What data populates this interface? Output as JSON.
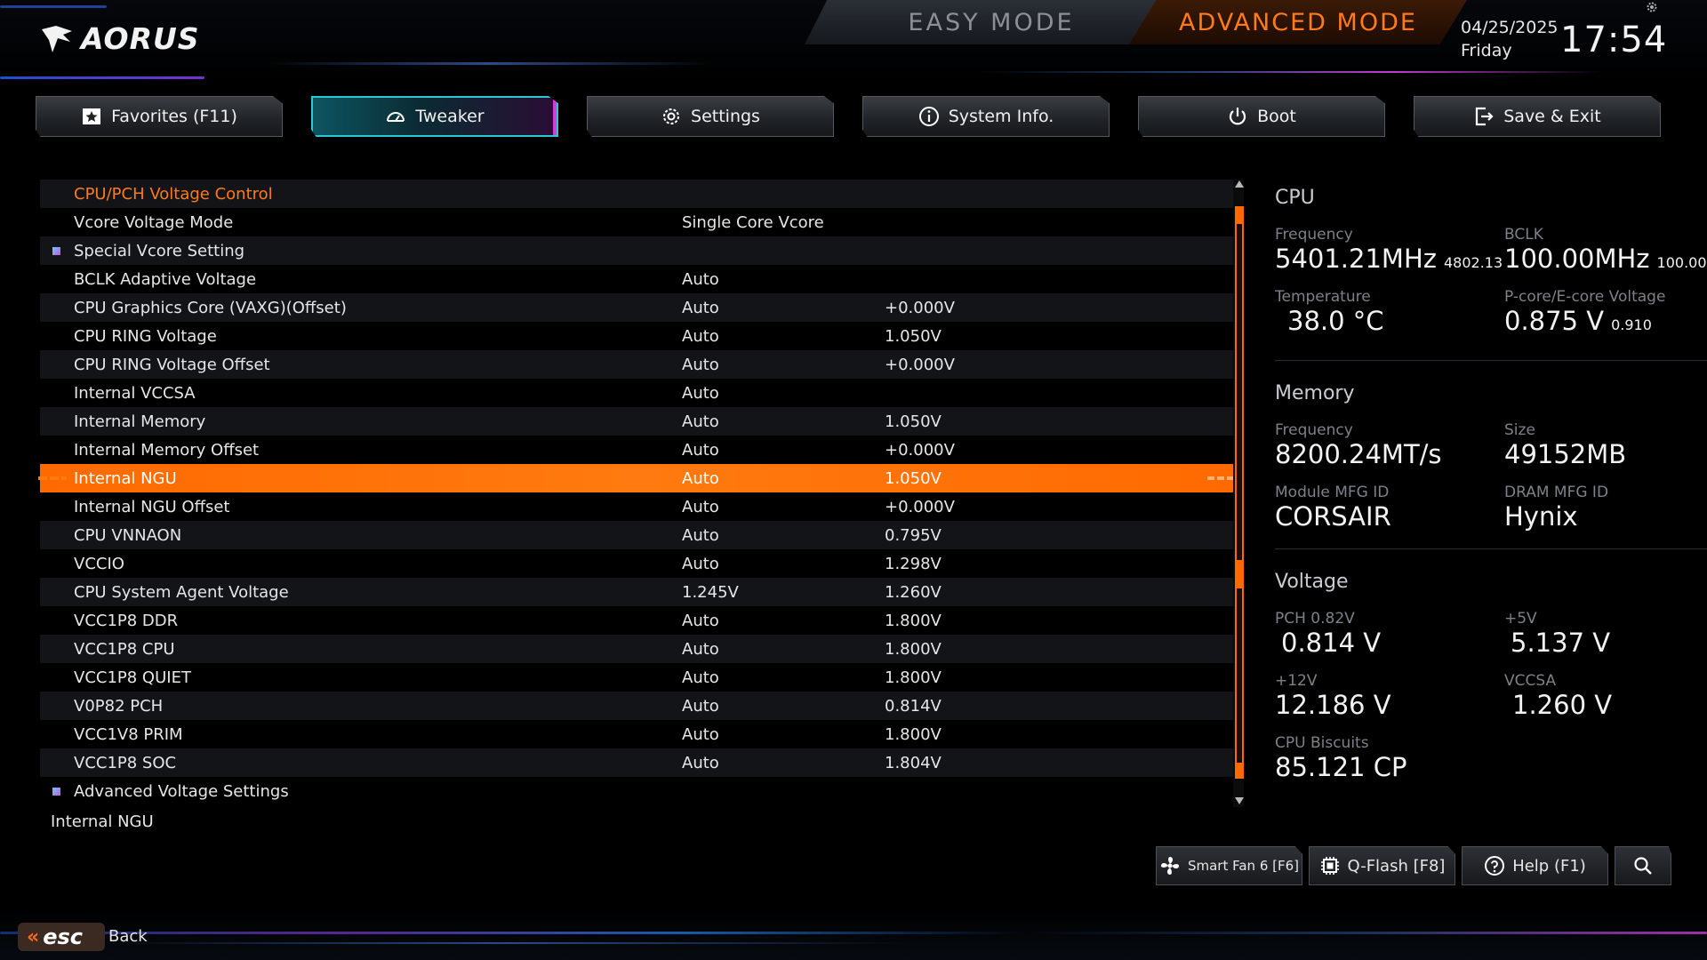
{
  "brand": {
    "logo_text": "AORUS"
  },
  "modes": {
    "easy": "EASY MODE",
    "advanced": "ADVANCED MODE"
  },
  "datetime": {
    "date": "04/25/2025",
    "day": "Friday",
    "time": "17:54"
  },
  "tabs": [
    {
      "label": "Favorites (F11)",
      "icon": "star-icon",
      "active": false
    },
    {
      "label": "Tweaker",
      "icon": "speedometer-icon",
      "active": true
    },
    {
      "label": "Settings",
      "icon": "gear-icon",
      "active": false
    },
    {
      "label": "System Info.",
      "icon": "info-icon",
      "active": false
    },
    {
      "label": "Boot",
      "icon": "power-icon",
      "active": false
    },
    {
      "label": "Save & Exit",
      "icon": "exit-icon",
      "active": false
    }
  ],
  "list": {
    "rows": [
      {
        "name": "CPU/PCH Voltage Control",
        "value": "",
        "current": "",
        "type": "header"
      },
      {
        "name": "Vcore Voltage Mode",
        "value": "Single Core Vcore",
        "current": ""
      },
      {
        "name": "Special Vcore Setting",
        "value": "",
        "current": "",
        "type": "submenu"
      },
      {
        "name": "BCLK Adaptive Voltage",
        "value": "Auto",
        "current": ""
      },
      {
        "name": "CPU Graphics Core (VAXG)(Offset)",
        "value": "Auto",
        "current": "+0.000V"
      },
      {
        "name": "CPU RING Voltage",
        "value": "Auto",
        "current": "1.050V"
      },
      {
        "name": "CPU RING Voltage Offset",
        "value": "Auto",
        "current": "+0.000V"
      },
      {
        "name": "Internal VCCSA",
        "value": "Auto",
        "current": ""
      },
      {
        "name": "Internal Memory",
        "value": "Auto",
        "current": "1.050V"
      },
      {
        "name": "Internal Memory Offset",
        "value": "Auto",
        "current": "+0.000V"
      },
      {
        "name": "Internal NGU",
        "value": "Auto",
        "current": "1.050V",
        "selected": true
      },
      {
        "name": "Internal NGU Offset",
        "value": "Auto",
        "current": "+0.000V"
      },
      {
        "name": "CPU VNNAON",
        "value": "Auto",
        "current": "0.795V"
      },
      {
        "name": "VCCIO",
        "value": "Auto",
        "current": "1.298V"
      },
      {
        "name": "CPU System Agent Voltage",
        "value": "1.245V",
        "current": "1.260V"
      },
      {
        "name": "VCC1P8 DDR",
        "value": "Auto",
        "current": "1.800V"
      },
      {
        "name": "VCC1P8 CPU",
        "value": "Auto",
        "current": "1.800V"
      },
      {
        "name": "VCC1P8 QUIET",
        "value": "Auto",
        "current": "1.800V"
      },
      {
        "name": "V0P82 PCH",
        "value": "Auto",
        "current": "0.814V"
      },
      {
        "name": "VCC1V8 PRIM",
        "value": "Auto",
        "current": "1.800V"
      },
      {
        "name": "VCC1P8 SOC",
        "value": "Auto",
        "current": "1.804V"
      },
      {
        "name": "Advanced Voltage Settings",
        "value": "",
        "current": "",
        "type": "submenu"
      }
    ],
    "help_text": "Internal NGU"
  },
  "panel": {
    "cpu": {
      "title": "CPU",
      "frequency_label": "Frequency",
      "frequency": "5401.21MHz",
      "frequency_small": "4802.13",
      "bclk_label": "BCLK",
      "bclk": "100.00MHz",
      "bclk_small": "100.00",
      "temp_label": "Temperature",
      "temp": "38.0 °C",
      "voltage_label": "P-core/E-core Voltage",
      "voltage": "0.875 V",
      "voltage_small": "0.910"
    },
    "memory": {
      "title": "Memory",
      "frequency_label": "Frequency",
      "frequency": "8200.24MT/s",
      "size_label": "Size",
      "size": "49152MB",
      "module_label": "Module MFG ID",
      "module": "CORSAIR",
      "dram_label": "DRAM MFG ID",
      "dram": "Hynix"
    },
    "voltage": {
      "title": "Voltage",
      "pch_label": "PCH 0.82V",
      "pch": "0.814 V",
      "v5_label": "+5V",
      "v5": "5.137 V",
      "v12_label": "+12V",
      "v12": "12.186 V",
      "vccsa_label": "VCCSA",
      "vccsa": "1.260 V",
      "biscuits_label": "CPU Biscuits",
      "biscuits": "85.121 CP"
    }
  },
  "bottom": {
    "smartfan": "Smart Fan 6 [F6]",
    "qflash": "Q-Flash [F8]",
    "help": "Help (F1)",
    "esc": "esc",
    "back": "Back"
  },
  "colors": {
    "accent": "#ff6a00",
    "active_tab": "#2ac7d4",
    "header": "#ff7a1a"
  }
}
